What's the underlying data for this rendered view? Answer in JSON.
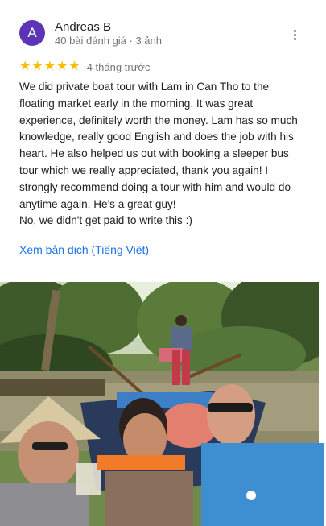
{
  "review": {
    "avatar_letter": "A",
    "author_name": "Andreas B",
    "author_meta": "40 bài đánh giá · 3 ảnh",
    "rating": 5,
    "star_glyph": "★",
    "date": "4 tháng trước",
    "text": "We did private boat tour with Lam in Can Tho to the floating market early in the morning. It was great experience, definitely worth the money. Lam has so much knowledge, really good English and does the job with his heart. He also helped us out with booking a sleeper bus tour which we really appreciated, thank you again! I strongly recommend doing a tour with him and would do anytime again. He's a great guy!\nNo, we didn't get paid to write this :)",
    "translate_link": "Xem bản dịch (Tiếng Việt)"
  },
  "colors": {
    "avatar_bg": "#5b35b5",
    "star": "#fbbc04",
    "link": "#1a73e8",
    "meta_text": "#70757a"
  },
  "icons": {
    "more": "more-vert-icon",
    "star": "star-icon"
  }
}
